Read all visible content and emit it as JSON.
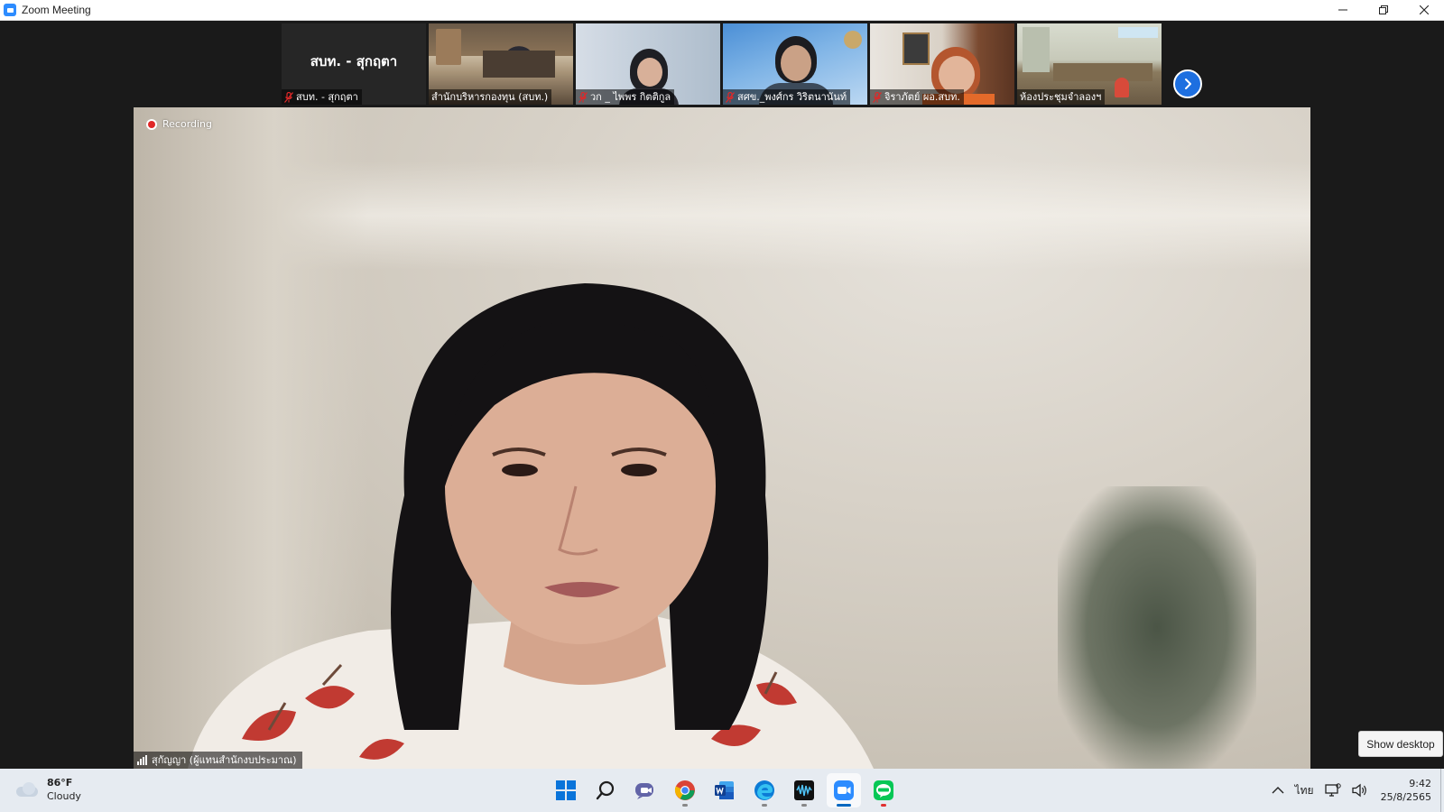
{
  "window": {
    "title": "Zoom Meeting"
  },
  "gallery": {
    "tiles": [
      {
        "type": "name-card",
        "display_name": "สบท. - สุกฤตา",
        "caption": "สบท. - สุกฤตา",
        "muted": true
      },
      {
        "type": "video",
        "caption": "สำนักบริหารกองทุน (สบท.)",
        "muted": false
      },
      {
        "type": "video",
        "caption": "วก _ ไพพร กิตติกูล",
        "muted": true
      },
      {
        "type": "video",
        "caption": "สศข._พงศ์กร วิริตนานันท์",
        "muted": true
      },
      {
        "type": "video",
        "caption": "จิราภัตย์ ผอ.สบท.",
        "muted": true
      },
      {
        "type": "video",
        "caption": "ห้องประชุมจำลองฯ",
        "muted": false
      }
    ]
  },
  "main_video": {
    "recording_label": "Recording",
    "speaker_name": "สุกัญญา (ผู้แทนสำนักงบประมาณ)"
  },
  "overlay": {
    "show_desktop": "Show desktop"
  },
  "taskbar": {
    "weather": {
      "temp": "86°F",
      "condition": "Cloudy"
    },
    "apps": [
      {
        "name": "start-icon"
      },
      {
        "name": "search-icon"
      },
      {
        "name": "teams-chat-icon"
      },
      {
        "name": "chrome-icon"
      },
      {
        "name": "word-icon"
      },
      {
        "name": "edge-icon"
      },
      {
        "name": "audio-app-icon"
      },
      {
        "name": "zoom-icon"
      },
      {
        "name": "line-icon"
      }
    ],
    "language": "ไทย",
    "time": "9:42",
    "date": "25/8/2565"
  },
  "colors": {
    "zoom_blue": "#2d8cff",
    "recording_red": "#e02828",
    "mute_red": "#e02828",
    "taskbar_bg": "#e6ebf1"
  }
}
